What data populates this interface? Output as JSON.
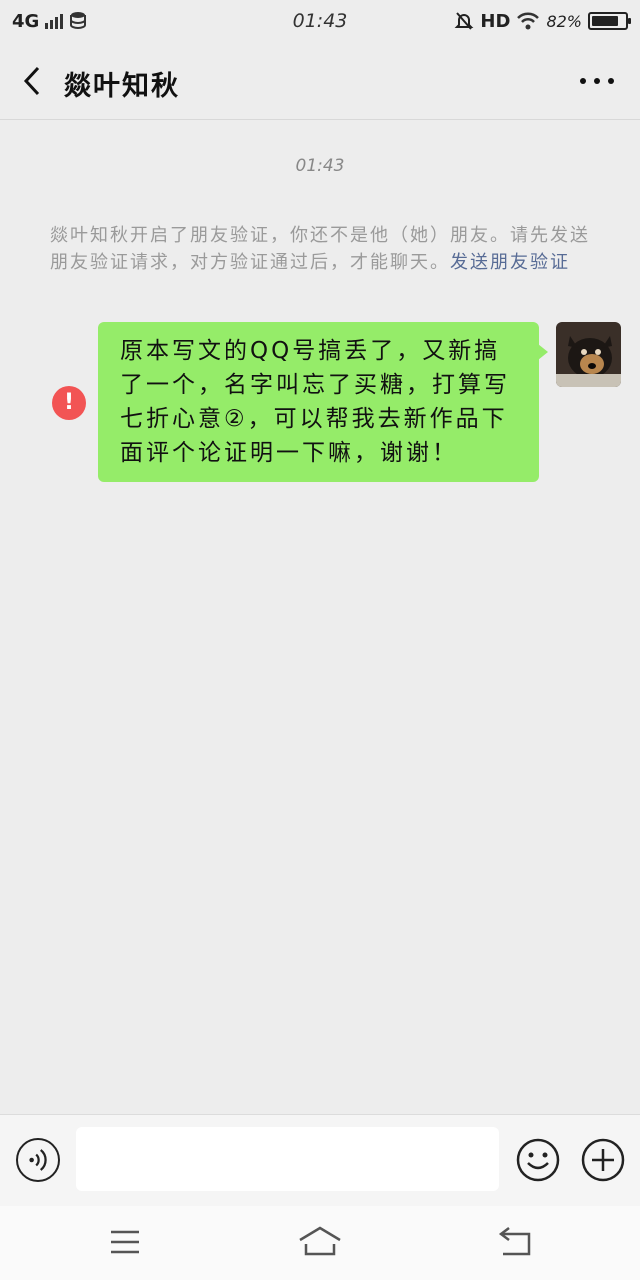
{
  "status_bar": {
    "network": "4G",
    "time": "01:43",
    "hd": "HD",
    "battery": "82%",
    "battery_level": 0.82
  },
  "header": {
    "title": "燚叶知秋",
    "back_icon": "chevron-left-icon",
    "more_icon": "more-dots-icon"
  },
  "chat": {
    "timestamp": "01:43",
    "system_notice_text": "燚叶知秋开启了朋友验证，你还不是他（她）朋友。请先发送朋友验证请求，对方验证通过后，才能聊天。",
    "system_notice_link": "发送朋友验证",
    "message": {
      "text": "原本写文的QQ号搞丢了，又新搞了一个，名字叫忘了买糖，打算写七折心意②，可以帮我去新作品下面评个论证明一下嘛，谢谢！",
      "status_icon": "error-icon",
      "status_glyph": "!"
    }
  },
  "input_bar": {
    "voice_icon": "voice-icon",
    "input_value": "",
    "emoji_icon": "emoji-icon",
    "plus_icon": "plus-icon"
  },
  "nav_bar": {
    "menu_icon": "menu-icon",
    "home_icon": "home-icon",
    "back_icon": "back-icon"
  },
  "colors": {
    "bubble": "#95ec69",
    "link": "#576b95",
    "error": "#f25454",
    "background": "#ededed"
  }
}
